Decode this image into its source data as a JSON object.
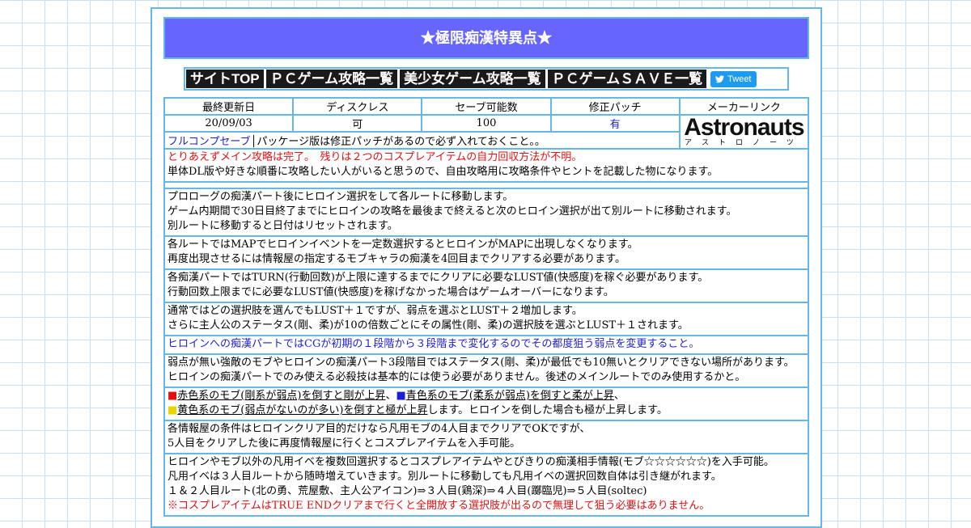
{
  "title": "★極限痴漢特異点★",
  "nav": {
    "items": [
      "サイトTOP",
      "ＰＣゲーム攻略一覧",
      "美少女ゲーム攻略一覧",
      "ＰＣゲームＳＡＶＥ一覧"
    ],
    "tweet": "Tweet"
  },
  "info": {
    "headers": [
      "最終更新日",
      "ディスクレス",
      "セーブ可能数",
      "修正パッチ",
      "メーカーリンク"
    ],
    "values": [
      "20/09/03",
      "可",
      "100",
      "有"
    ],
    "maker_logo": "Astronauts",
    "maker_logo_sub": "アストロノーツ",
    "fullcomp_link": "フルコンプセーブ",
    "fullcomp_note": "パッケージ版は修正パッチがあるので必ず入れておくこと。。"
  },
  "intro": {
    "red": "とりあえずメイン攻略は完了。　残りは２つのコスプレアイテムの自力回収方法が不明。",
    "line": "単体DL版や好きな順番に攻略したい人がいると思うので、自由攻略用に攻略条件やヒントを記載した物になります。"
  },
  "blocks": [
    [
      "プロローグの痴漢パート後にヒロイン選択をして各ルートに移動します。",
      "ゲーム内期間で30日目終了までにヒロインの攻略を最後まで終えると次のヒロイン選択が出て別ルートに移動されます。",
      "別ルートに移動すると日付はリセットされます。"
    ],
    [
      "各ルートではMAPでヒロインイベントを一定数選択するとヒロインがMAPに出現しなくなります。",
      "再度出現させるには情報屋の指定するモブキャラの痴漢を4回目までクリアする必要があります。"
    ],
    [
      "各痴漢パートではTURN(行動回数)が上限に達するまでにクリアに必要なLUST値(快感度)を稼ぐ必要があります。",
      "行動回数上限までに必要なLUST値(快感度)を稼げなかった場合はゲームオーバーになります。"
    ],
    [
      "通常ではどの選択肢を選んでもLUST＋１ですが、弱点を選ぶとLUST＋２増加します。",
      "さらに主人公のステータス(剛、柔)が10の倍数ごとにその属性(剛、柔)の選択肢を選ぶとLUST＋１されます。"
    ]
  ],
  "blue_note": "ヒロインへの痴漢パートではCGが初期の１段階から３段階まで変化するのでその都度狙う弱点を変更すること。",
  "weak": [
    "弱点が無い強敵のモブやヒロインの痴漢パート3段階目ではステータス(剛、柔)が最低でも10無いとクリアできない場所があります。",
    "ヒロインの痴漢パートでのみ使える必殺技は基本的には使う必要がありません。後述のメインルートでのみ使用するかと。"
  ],
  "mob": {
    "square": "■",
    "red_u": "赤色系のモブ(剛系が弱点)を倒すと剛が上昇",
    "sep": "、",
    "blue_u": "青色系のモブ(柔系が弱点)を倒すと柔が上昇",
    "end1": "、",
    "yellow_u": "黄色系のモブ(弱点がないのが多い)を倒すと極が上昇",
    "end2": "します。ヒロインを倒した場合も極が上昇します。"
  },
  "info_shop": [
    "各情報屋の条件はヒロインクリア目的だけなら凡用モブの4人目までクリアでOKですが、",
    "5人目をクリアした後に再度情報屋に行くとコスプレアイテムを入手可能。"
  ],
  "events": [
    "ヒロインやモブ以外の凡用イベを複数回選択するとコスプレアイテムやとびきりの痴漢相手情報(モブ☆☆☆☆☆☆)を入手可能。",
    "凡用イベは３人目ルートから随時増えていきます。別ルートに移動しても凡用イベの選択回数自体は引き継がれます。",
    "１＆２人目ルート(北の勇、荒屋敷、主人公アイコン)⇒３人目(鶏深)⇒４人目(躑臨児)⇒５人目(soltec)"
  ],
  "events_red": "※コスプレアイテムはTRUE ENDクリアまで行くと全開放する選択肢が出るので無理して狙う必要はありません。",
  "colors": {
    "title_bg": "#6666ff",
    "border": "#63b8e8",
    "nav_bg": "#1a1a1a",
    "tweet": "#1d9bf0",
    "red": "#e01010",
    "blue": "#1d1dd6"
  }
}
